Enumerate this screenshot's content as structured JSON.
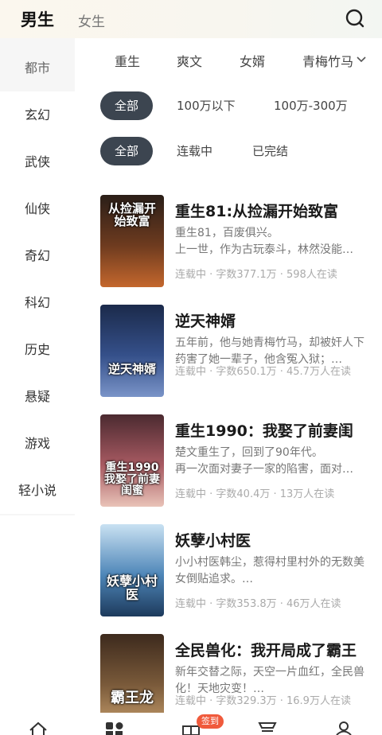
{
  "header": {
    "tabs": [
      {
        "label": "男生",
        "active": true
      },
      {
        "label": "女生",
        "active": false
      }
    ],
    "search_icon": "search-icon"
  },
  "sidebar": {
    "items": [
      {
        "label": "都市",
        "active": false
      },
      {
        "label": "玄幻",
        "active": true
      },
      {
        "label": "武侠",
        "active": true
      },
      {
        "label": "仙侠",
        "active": true
      },
      {
        "label": "奇幻",
        "active": true
      },
      {
        "label": "科幻",
        "active": true
      },
      {
        "label": "历史",
        "active": true
      },
      {
        "label": "悬疑",
        "active": true
      },
      {
        "label": "游戏",
        "active": true
      },
      {
        "label": "轻小说",
        "active": true
      }
    ]
  },
  "subcategories": [
    "重生",
    "爽文",
    "女婿",
    "青梅竹马"
  ],
  "filters": {
    "wordcount": [
      "全部",
      "100万以下",
      "100万-300万"
    ],
    "status": [
      "全部",
      "连载中",
      "已完结"
    ]
  },
  "books": [
    {
      "title": "重生81:从捡漏开始致富",
      "desc": "重生81，百废俱兴。\n上一世，作为古玩泰斗，林然没能…",
      "meta": "连载中 · 字数377.1万 · 598人在读",
      "cover_text": "从捡漏开始致富",
      "cover_colors": [
        "#2a1e18",
        "#6e3b1f",
        "#c4672d"
      ]
    },
    {
      "title": "逆天神婿",
      "desc": "五年前，他与她青梅竹马，却被奸人下药害了她一辈子，他含冤入狱；…",
      "meta": "连载中 · 字数650.1万 · 45.7万人在读",
      "cover_text": "逆天神婿",
      "cover_colors": [
        "#1b2a4a",
        "#35508a",
        "#7a94c8"
      ]
    },
    {
      "title": "重生1990：我娶了前妻闺",
      "desc": "楚文重生了，回到了90年代。\n再一次面对妻子一家的陷害，面对…",
      "meta": "连载中 · 字数40.4万 · 13万人在读",
      "cover_text": "重生1990 我娶了前妻闺蜜",
      "cover_colors": [
        "#4b2a30",
        "#a85a62",
        "#e9c3b8"
      ]
    },
    {
      "title": "妖孽小村医",
      "desc": "小小村医韩尘，惹得村里村外的无数美女倒贴追求。…",
      "meta": "连载中 · 字数353.8万 · 46万人在读",
      "cover_text": "妖孽小村医",
      "cover_colors": [
        "#1d3a5c",
        "#4e86b8",
        "#c9e1f2"
      ]
    },
    {
      "title": "全民兽化：我开局成了霸王",
      "desc": "新年交替之际，天空一片血红，全民兽化！天地灾变！…",
      "meta": "连载中 · 字数329.3万 · 16.9万人在读",
      "cover_text": "霸王龙",
      "cover_colors": [
        "#3d2a1d",
        "#7a5a3a",
        "#c29a6a"
      ]
    }
  ],
  "bottom_nav": {
    "icons": [
      "home-icon",
      "category-icon",
      "gift-icon",
      "bookshelf-icon",
      "profile-icon"
    ],
    "badge": "签到",
    "accent": "#f05a3c"
  }
}
